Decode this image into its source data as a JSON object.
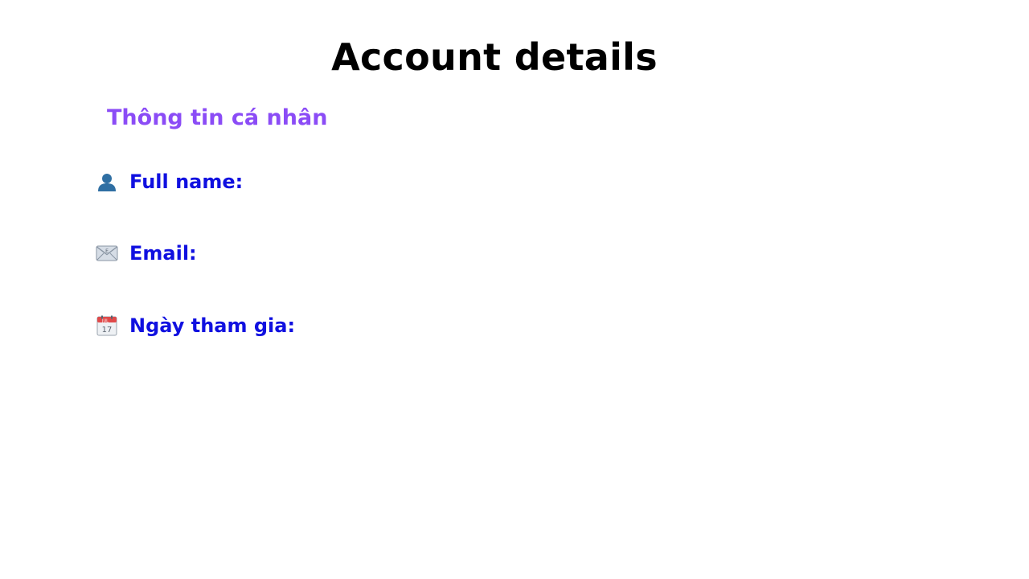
{
  "page": {
    "title": "Account details"
  },
  "section": {
    "title": "Thông tin cá nhân",
    "color": "#8b4cf6"
  },
  "details": [
    {
      "icon": "user-silhouette-icon",
      "label": "Full name:",
      "value": ""
    },
    {
      "icon": "envelope-icon",
      "label": "Email:",
      "value": ""
    },
    {
      "icon": "calendar-icon",
      "label": "Ngày tham gia:",
      "value": ""
    }
  ],
  "colors": {
    "label": "#1010e0",
    "title": "#000000"
  }
}
